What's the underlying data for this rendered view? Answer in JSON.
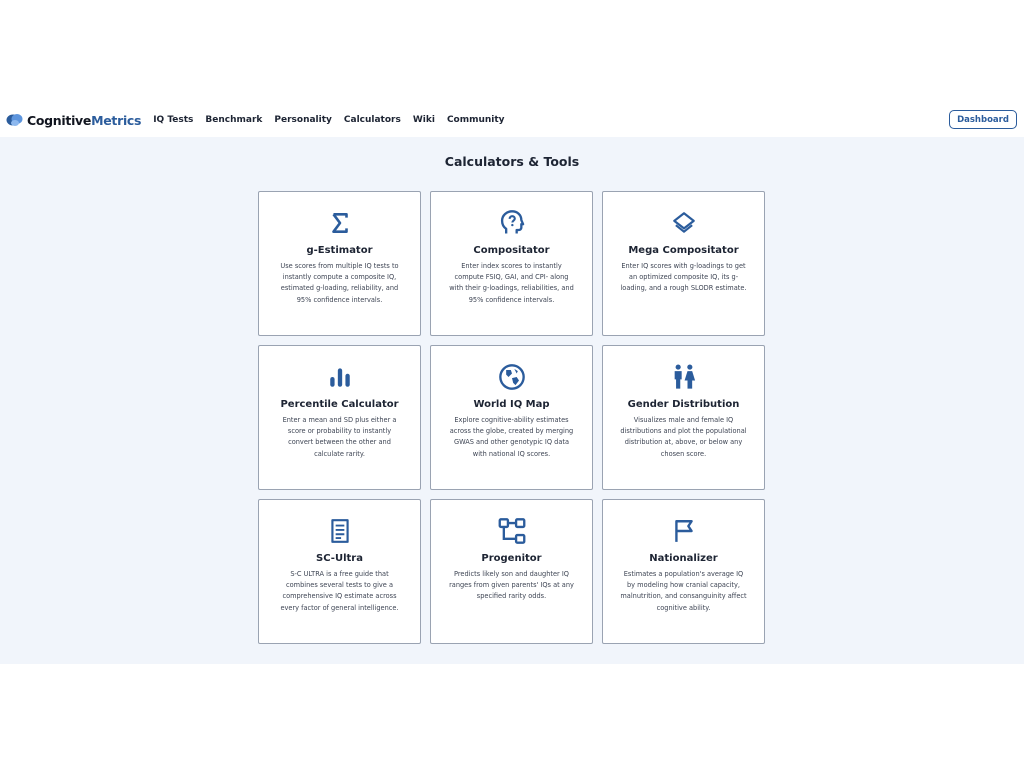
{
  "brand": {
    "name_part1": "Cognitive",
    "name_part2": "Metrics",
    "accent_color": "#2b5c9c"
  },
  "nav": {
    "links": [
      "IQ Tests",
      "Benchmark",
      "Personality",
      "Calculators",
      "Wiki",
      "Community"
    ],
    "dashboard_label": "Dashboard"
  },
  "page": {
    "title": "Calculators & Tools"
  },
  "cards": [
    {
      "title": "g-Estimator",
      "icon": "sigma-icon",
      "description": "Use scores from multiple IQ tests to instantly compute a composite IQ, estimated g-loading, reliability, and 95% confidence intervals."
    },
    {
      "title": "Compositator",
      "icon": "head-question-icon",
      "description": "Enter index scores to instantly compute FSIQ, GAI, and CPI- along with their g-loadings, reliabilities, and 95% confidence intervals."
    },
    {
      "title": "Mega Compositator",
      "icon": "layers-icon",
      "description": "Enter IQ scores with g-loadings to get an optimized composite IQ, its g-loading, and a rough SLODR estimate."
    },
    {
      "title": "Percentile Calculator",
      "icon": "bar-chart-icon",
      "description": "Enter a mean and SD plus either a score or probability to instantly convert between the other and calculate rarity."
    },
    {
      "title": "World IQ Map",
      "icon": "globe-icon",
      "description": "Explore cognitive-ability estimates across the globe, created by merging GWAS and other genotypic IQ data with national IQ scores."
    },
    {
      "title": "Gender Distribution",
      "icon": "gender-icon",
      "description": "Visualizes male and female IQ distributions and plot the populational distribution at, above, or below any chosen score."
    },
    {
      "title": "SC-Ultra",
      "icon": "document-icon",
      "description": "S-C ULTRA is a free guide that combines several tests to give a comprehensive IQ estimate across every factor of general intelligence."
    },
    {
      "title": "Progenitor",
      "icon": "hierarchy-icon",
      "description": "Predicts likely son and daughter IQ ranges from given parents' IQs at any specified rarity odds."
    },
    {
      "title": "Nationalizer",
      "icon": "flag-icon",
      "description": "Estimates a population's average IQ by modeling how cranial capacity, malnutrition, and consanguinity affect cognitive ability."
    }
  ]
}
